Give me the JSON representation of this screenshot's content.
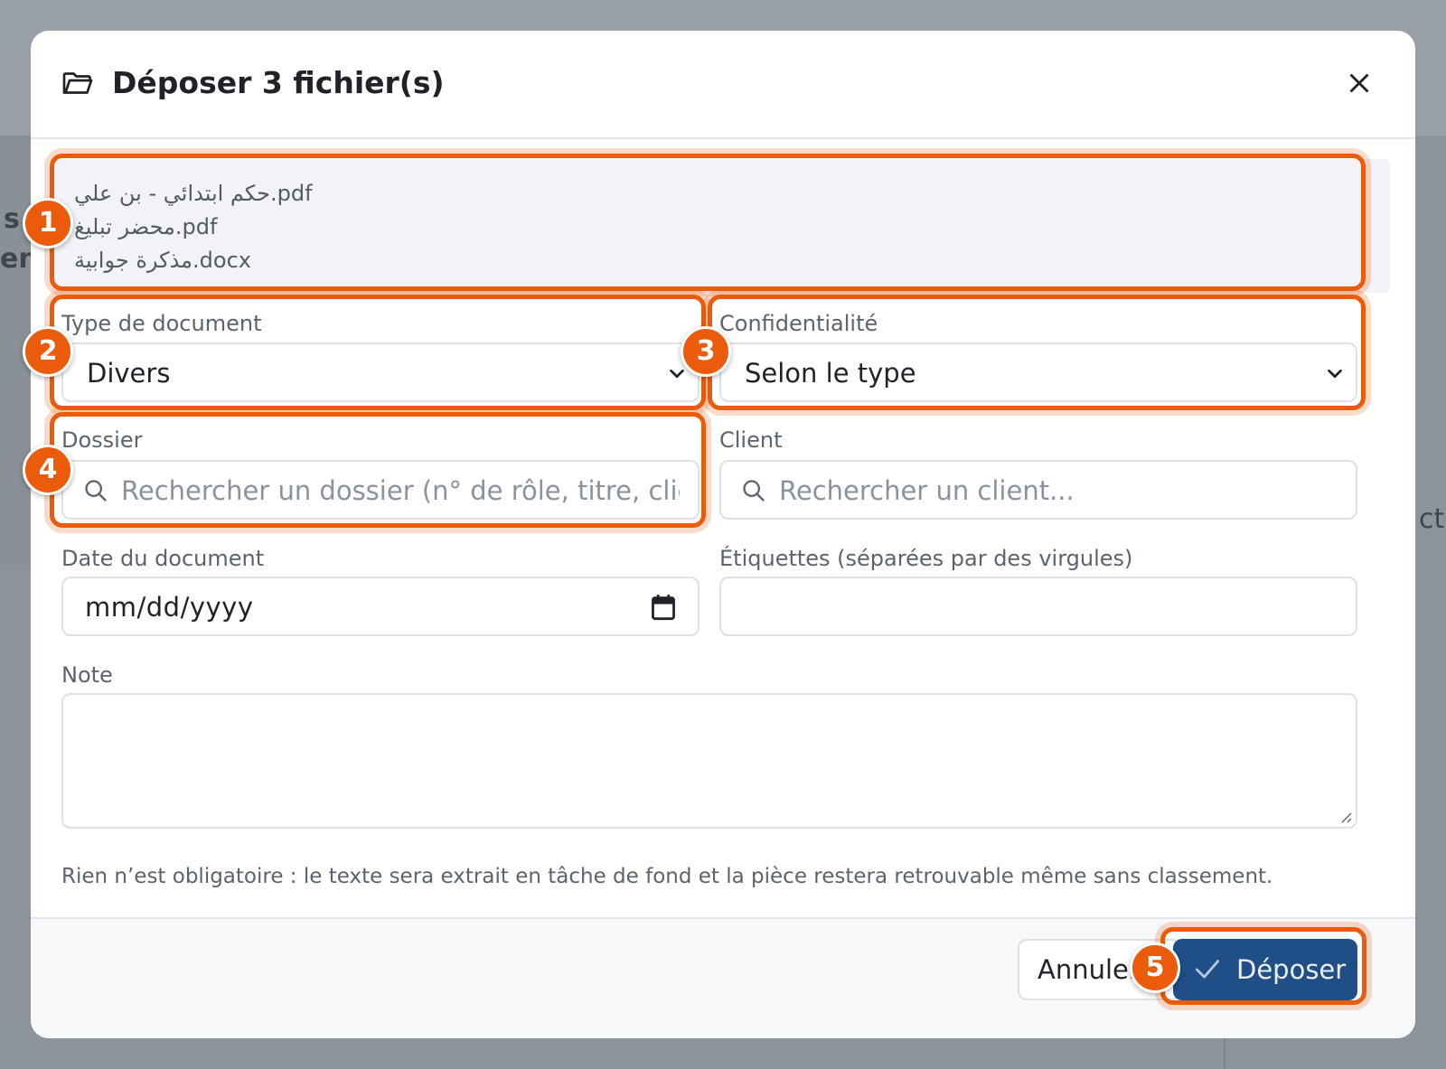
{
  "dialog": {
    "title": "Déposer 3 fichier(s)",
    "files": [
      "حكم ابتدائي - بن علي.pdf",
      "محضر تبليغ.pdf",
      "مذكرة جوابية.docx"
    ]
  },
  "form": {
    "type_label": "Type de document",
    "type_value": "Divers",
    "confidentiality_label": "Confidentialité",
    "confidentiality_value": "Selon le type",
    "dossier_label": "Dossier",
    "dossier_placeholder": "Rechercher un dossier (n° de rôle, titre, client",
    "client_label": "Client",
    "client_placeholder": "Rechercher un client...",
    "date_label": "Date du document",
    "date_value": "mm/dd/yyyy",
    "tags_label": "Étiquettes (séparées par des virgules)",
    "tags_value": "",
    "note_label": "Note",
    "note_value": "",
    "help_text": "Rien n’est obligatoire : le texte sera extrait en tâche de fond et la pièce restera retrouvable même sans classement."
  },
  "footer": {
    "cancel_label": "Annuler",
    "submit_label": "Déposer"
  },
  "annotations": {
    "badges": [
      "1",
      "2",
      "3",
      "4",
      "5"
    ],
    "color": "#ea5b0c"
  },
  "background": {
    "partial_texts": [
      "s",
      "ent",
      "ctio"
    ]
  },
  "colors": {
    "primary": "#1f4f86",
    "overlay": "#8d939b"
  }
}
